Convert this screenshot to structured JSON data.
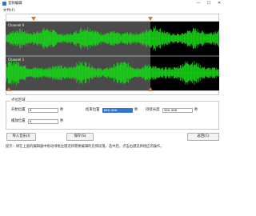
{
  "window": {
    "title": "音频编辑",
    "minimize": "—",
    "maximize": "☐",
    "close": "✕"
  },
  "menu": {
    "file": "文件(F)"
  },
  "waveform": {
    "channels": [
      {
        "label": "Channel 0"
      },
      {
        "label": "Channel 1"
      }
    ],
    "colors": {
      "wave": "#18d418",
      "selection": "#4a4a4a",
      "background": "#000000",
      "marker": "#e8701a"
    }
  },
  "point_settings": {
    "group_title": "点位区域",
    "start_label": "开始位置",
    "start_value": "0",
    "start_unit": "秒",
    "end_label": "结束位置",
    "end_value": "800.000",
    "end_unit": "秒",
    "duration_label": "持续长度",
    "duration_value": "500.000",
    "duration_unit": "秒",
    "insert_label": "播放位置",
    "insert_value": "0",
    "insert_unit": "秒"
  },
  "buttons": {
    "import": "导入音乐(I)",
    "save": "保存(S)",
    "back": "返回(C)"
  },
  "tip": "提示：请在上面的编辑器中拖动绿框左键选择需要编辑的音频段落，选中后，点击右键选择相应的操作。"
}
